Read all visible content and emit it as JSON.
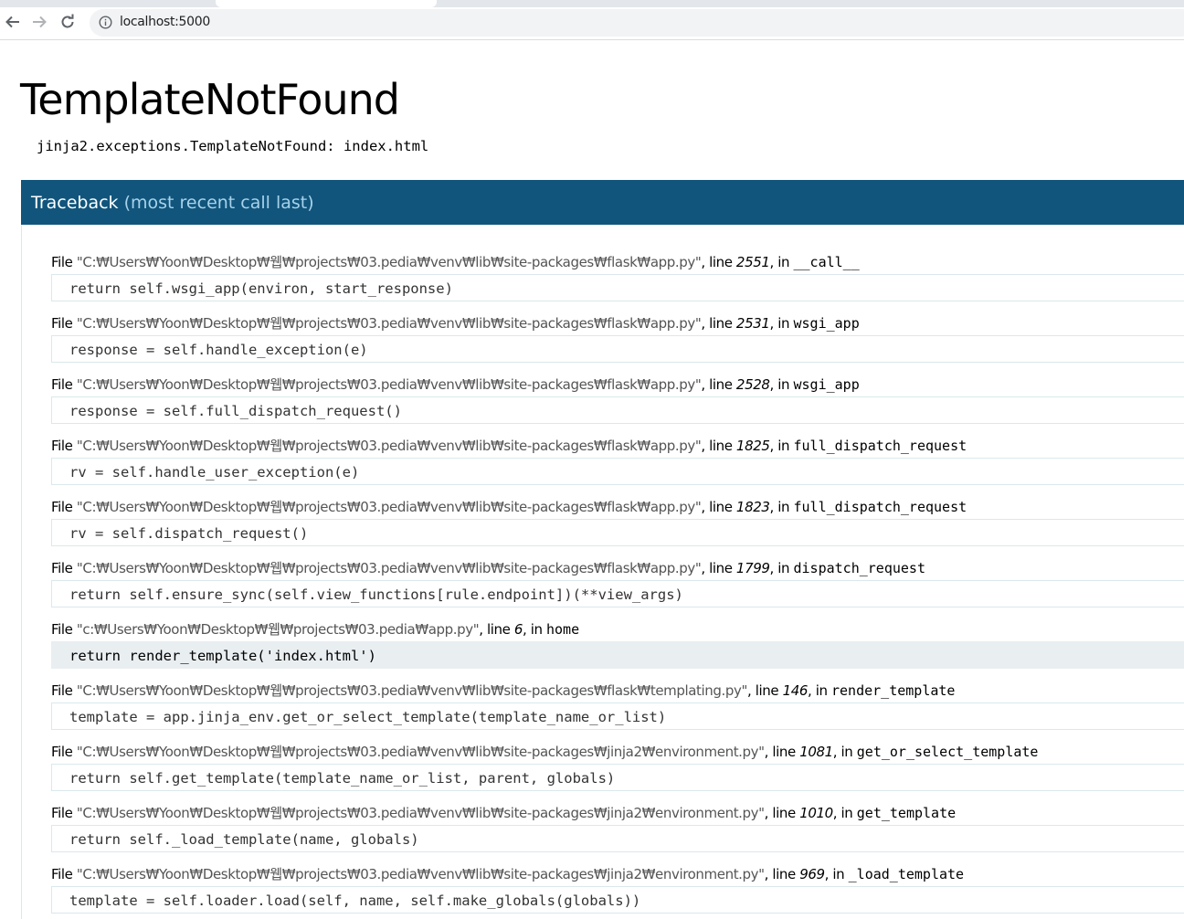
{
  "browser": {
    "url": "localhost:5000"
  },
  "page": {
    "title": "TemplateNotFound",
    "error_message": "jinja2.exceptions.TemplateNotFound: index.html"
  },
  "traceback": {
    "title": "Traceback",
    "subtitle": "(most recent call last)",
    "frames": [
      {
        "prefix": "File ",
        "filename": "\"C:₩Users₩Yoon₩Desktop₩웹₩projects₩03.pedia₩venv₩lib₩site-packages₩flask₩app.py\"",
        "line_label": ", line ",
        "line": "2551",
        "in_label": ", in ",
        "func": "__call__",
        "code": "return self.wsgi_app(environ, start_response)"
      },
      {
        "prefix": "File ",
        "filename": "\"C:₩Users₩Yoon₩Desktop₩웹₩projects₩03.pedia₩venv₩lib₩site-packages₩flask₩app.py\"",
        "line_label": ", line ",
        "line": "2531",
        "in_label": ", in ",
        "func": "wsgi_app",
        "code": "response = self.handle_exception(e)"
      },
      {
        "prefix": "File ",
        "filename": "\"C:₩Users₩Yoon₩Desktop₩웹₩projects₩03.pedia₩venv₩lib₩site-packages₩flask₩app.py\"",
        "line_label": ", line ",
        "line": "2528",
        "in_label": ", in ",
        "func": "wsgi_app",
        "code": "response = self.full_dispatch_request()"
      },
      {
        "prefix": "File ",
        "filename": "\"C:₩Users₩Yoon₩Desktop₩웹₩projects₩03.pedia₩venv₩lib₩site-packages₩flask₩app.py\"",
        "line_label": ", line ",
        "line": "1825",
        "in_label": ", in ",
        "func": "full_dispatch_request",
        "code": "rv = self.handle_user_exception(e)"
      },
      {
        "prefix": "File ",
        "filename": "\"C:₩Users₩Yoon₩Desktop₩웹₩projects₩03.pedia₩venv₩lib₩site-packages₩flask₩app.py\"",
        "line_label": ", line ",
        "line": "1823",
        "in_label": ", in ",
        "func": "full_dispatch_request",
        "code": "rv = self.dispatch_request()"
      },
      {
        "prefix": "File ",
        "filename": "\"C:₩Users₩Yoon₩Desktop₩웹₩projects₩03.pedia₩venv₩lib₩site-packages₩flask₩app.py\"",
        "line_label": ", line ",
        "line": "1799",
        "in_label": ", in ",
        "func": "dispatch_request",
        "code": "return self.ensure_sync(self.view_functions[rule.endpoint])(**view_args)"
      },
      {
        "prefix": "File ",
        "filename": "\"c:₩Users₩Yoon₩Desktop₩웹₩projects₩03.pedia₩app.py\"",
        "line_label": ", line ",
        "line": "6",
        "in_label": ", in ",
        "func": "home",
        "code": "return render_template('index.html')",
        "current": true
      },
      {
        "prefix": "File ",
        "filename": "\"C:₩Users₩Yoon₩Desktop₩웹₩projects₩03.pedia₩venv₩lib₩site-packages₩flask₩templating.py\"",
        "line_label": ", line ",
        "line": "146",
        "in_label": ", in ",
        "func": "render_template",
        "code": "template = app.jinja_env.get_or_select_template(template_name_or_list)"
      },
      {
        "prefix": "File ",
        "filename": "\"C:₩Users₩Yoon₩Desktop₩웹₩projects₩03.pedia₩venv₩lib₩site-packages₩jinja2₩environment.py\"",
        "line_label": ", line ",
        "line": "1081",
        "in_label": ", in ",
        "func": "get_or_select_template",
        "code": "return self.get_template(template_name_or_list, parent, globals)"
      },
      {
        "prefix": "File ",
        "filename": "\"C:₩Users₩Yoon₩Desktop₩웹₩projects₩03.pedia₩venv₩lib₩site-packages₩jinja2₩environment.py\"",
        "line_label": ", line ",
        "line": "1010",
        "in_label": ", in ",
        "func": "get_template",
        "code": "return self._load_template(name, globals)"
      },
      {
        "prefix": "File ",
        "filename": "\"C:₩Users₩Yoon₩Desktop₩웹₩projects₩03.pedia₩venv₩lib₩site-packages₩jinja2₩environment.py\"",
        "line_label": ", line ",
        "line": "969",
        "in_label": ", in ",
        "func": "_load_template",
        "code": "template = self.loader.load(self, name, self.make_globals(globals))"
      }
    ]
  },
  "icons": {
    "back": "arrow-left-icon",
    "forward": "arrow-right-icon",
    "reload": "reload-icon",
    "site_info": "info-circle-icon"
  },
  "colors": {
    "traceback_header_bg": "#11557c",
    "traceback_subtitle": "#a8d2ea",
    "current_line_bg": "#e9eef1"
  }
}
